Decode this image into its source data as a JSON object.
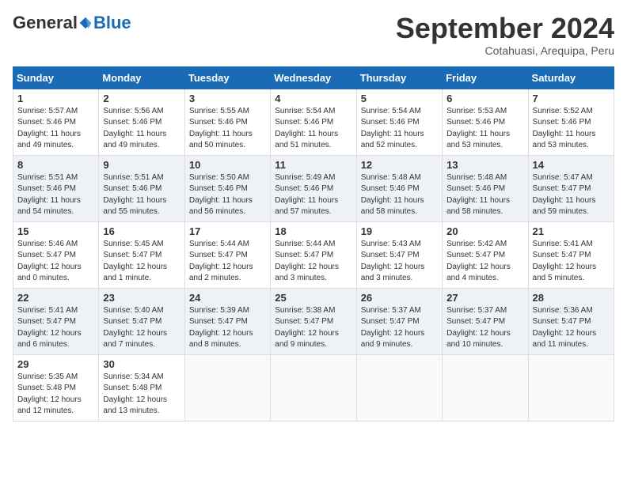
{
  "header": {
    "logo_general": "General",
    "logo_blue": "Blue",
    "month": "September 2024",
    "location": "Cotahuasi, Arequipa, Peru"
  },
  "weekdays": [
    "Sunday",
    "Monday",
    "Tuesday",
    "Wednesday",
    "Thursday",
    "Friday",
    "Saturday"
  ],
  "weeks": [
    [
      {
        "day": "1",
        "info": "Sunrise: 5:57 AM\nSunset: 5:46 PM\nDaylight: 11 hours\nand 49 minutes."
      },
      {
        "day": "2",
        "info": "Sunrise: 5:56 AM\nSunset: 5:46 PM\nDaylight: 11 hours\nand 49 minutes."
      },
      {
        "day": "3",
        "info": "Sunrise: 5:55 AM\nSunset: 5:46 PM\nDaylight: 11 hours\nand 50 minutes."
      },
      {
        "day": "4",
        "info": "Sunrise: 5:54 AM\nSunset: 5:46 PM\nDaylight: 11 hours\nand 51 minutes."
      },
      {
        "day": "5",
        "info": "Sunrise: 5:54 AM\nSunset: 5:46 PM\nDaylight: 11 hours\nand 52 minutes."
      },
      {
        "day": "6",
        "info": "Sunrise: 5:53 AM\nSunset: 5:46 PM\nDaylight: 11 hours\nand 53 minutes."
      },
      {
        "day": "7",
        "info": "Sunrise: 5:52 AM\nSunset: 5:46 PM\nDaylight: 11 hours\nand 53 minutes."
      }
    ],
    [
      {
        "day": "8",
        "info": "Sunrise: 5:51 AM\nSunset: 5:46 PM\nDaylight: 11 hours\nand 54 minutes."
      },
      {
        "day": "9",
        "info": "Sunrise: 5:51 AM\nSunset: 5:46 PM\nDaylight: 11 hours\nand 55 minutes."
      },
      {
        "day": "10",
        "info": "Sunrise: 5:50 AM\nSunset: 5:46 PM\nDaylight: 11 hours\nand 56 minutes."
      },
      {
        "day": "11",
        "info": "Sunrise: 5:49 AM\nSunset: 5:46 PM\nDaylight: 11 hours\nand 57 minutes."
      },
      {
        "day": "12",
        "info": "Sunrise: 5:48 AM\nSunset: 5:46 PM\nDaylight: 11 hours\nand 58 minutes."
      },
      {
        "day": "13",
        "info": "Sunrise: 5:48 AM\nSunset: 5:46 PM\nDaylight: 11 hours\nand 58 minutes."
      },
      {
        "day": "14",
        "info": "Sunrise: 5:47 AM\nSunset: 5:47 PM\nDaylight: 11 hours\nand 59 minutes."
      }
    ],
    [
      {
        "day": "15",
        "info": "Sunrise: 5:46 AM\nSunset: 5:47 PM\nDaylight: 12 hours\nand 0 minutes."
      },
      {
        "day": "16",
        "info": "Sunrise: 5:45 AM\nSunset: 5:47 PM\nDaylight: 12 hours\nand 1 minute."
      },
      {
        "day": "17",
        "info": "Sunrise: 5:44 AM\nSunset: 5:47 PM\nDaylight: 12 hours\nand 2 minutes."
      },
      {
        "day": "18",
        "info": "Sunrise: 5:44 AM\nSunset: 5:47 PM\nDaylight: 12 hours\nand 3 minutes."
      },
      {
        "day": "19",
        "info": "Sunrise: 5:43 AM\nSunset: 5:47 PM\nDaylight: 12 hours\nand 3 minutes."
      },
      {
        "day": "20",
        "info": "Sunrise: 5:42 AM\nSunset: 5:47 PM\nDaylight: 12 hours\nand 4 minutes."
      },
      {
        "day": "21",
        "info": "Sunrise: 5:41 AM\nSunset: 5:47 PM\nDaylight: 12 hours\nand 5 minutes."
      }
    ],
    [
      {
        "day": "22",
        "info": "Sunrise: 5:41 AM\nSunset: 5:47 PM\nDaylight: 12 hours\nand 6 minutes."
      },
      {
        "day": "23",
        "info": "Sunrise: 5:40 AM\nSunset: 5:47 PM\nDaylight: 12 hours\nand 7 minutes."
      },
      {
        "day": "24",
        "info": "Sunrise: 5:39 AM\nSunset: 5:47 PM\nDaylight: 12 hours\nand 8 minutes."
      },
      {
        "day": "25",
        "info": "Sunrise: 5:38 AM\nSunset: 5:47 PM\nDaylight: 12 hours\nand 9 minutes."
      },
      {
        "day": "26",
        "info": "Sunrise: 5:37 AM\nSunset: 5:47 PM\nDaylight: 12 hours\nand 9 minutes."
      },
      {
        "day": "27",
        "info": "Sunrise: 5:37 AM\nSunset: 5:47 PM\nDaylight: 12 hours\nand 10 minutes."
      },
      {
        "day": "28",
        "info": "Sunrise: 5:36 AM\nSunset: 5:47 PM\nDaylight: 12 hours\nand 11 minutes."
      }
    ],
    [
      {
        "day": "29",
        "info": "Sunrise: 5:35 AM\nSunset: 5:48 PM\nDaylight: 12 hours\nand 12 minutes."
      },
      {
        "day": "30",
        "info": "Sunrise: 5:34 AM\nSunset: 5:48 PM\nDaylight: 12 hours\nand 13 minutes."
      },
      {
        "day": "",
        "info": ""
      },
      {
        "day": "",
        "info": ""
      },
      {
        "day": "",
        "info": ""
      },
      {
        "day": "",
        "info": ""
      },
      {
        "day": "",
        "info": ""
      }
    ]
  ]
}
